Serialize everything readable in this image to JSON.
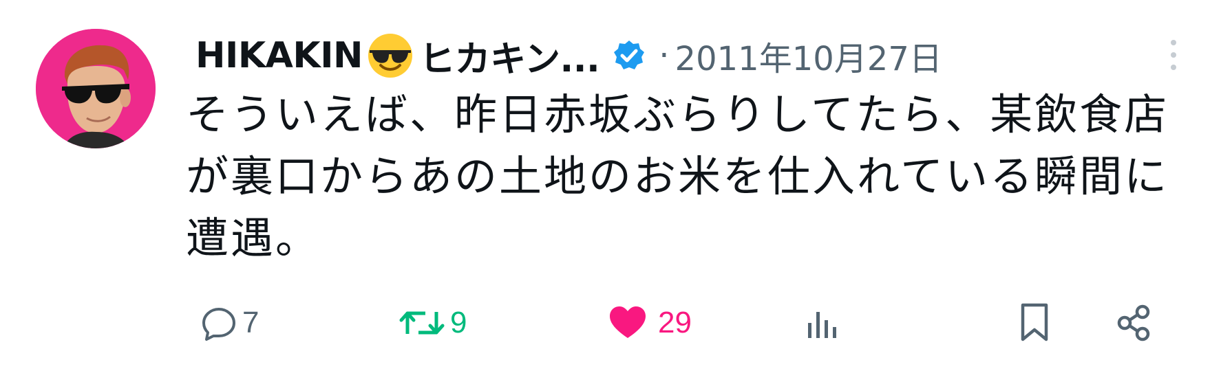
{
  "tweet": {
    "display_name": "HIKAKIN",
    "display_name_emoji": "smiling-face-with-sunglasses-emoji",
    "display_name_suffix": "ヒカキン...",
    "verified_icon": "verified-badge-icon",
    "separator": "·",
    "date": "2011年10月27日",
    "more_icon": "more-vertical-icon",
    "text": "そういえば、昨日赤坂ぶらりしてたら、某飲食店が裏口からあの土地のお米を仕入れている瞬間に遭遇。",
    "actions": {
      "reply_count": "7",
      "retweet_count": "9",
      "like_count": "29",
      "views_count": ""
    }
  },
  "colors": {
    "avatar_bg": "#ee2a8c",
    "verified": "#1d9bf0",
    "retweet": "#00ba7c",
    "like": "#f91880",
    "muted": "#536471"
  }
}
